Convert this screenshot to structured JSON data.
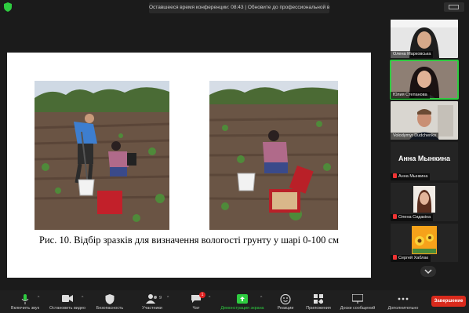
{
  "banner": {
    "text": "Оставшееся время конференции: 08:43 | Обновите до профессиональной версии"
  },
  "slide": {
    "caption": "Рис. 10. Відбір зразків для визначення вологості грунту у шарі 0-100 см"
  },
  "participants": [
    {
      "name": "Олена Марковська",
      "video": true,
      "active": false,
      "muted": false
    },
    {
      "name": "Юлия Степанова",
      "video": true,
      "active": true,
      "muted": false
    },
    {
      "name": "Volodymyr Dudchenko",
      "video": true,
      "active": false,
      "muted": false
    },
    {
      "name": "Анна Мынкина",
      "display_name": "Анна Мынкина",
      "video": false,
      "active": false,
      "muted": true
    },
    {
      "name": "Олена Сидакіна",
      "video": true,
      "active": false,
      "muted": true
    },
    {
      "name": "Сергей Хаблак",
      "video": true,
      "active": false,
      "muted": true
    }
  ],
  "toolbar": {
    "mute": "Включить звук",
    "video": "Остановить видео",
    "security": "Безопасность",
    "participants": "Участники",
    "participants_count": "9",
    "chat": "Чат",
    "chat_badge": "1",
    "share": "Демонстрация экрана",
    "reactions": "Реакции",
    "apps": "Приложения",
    "whiteboards": "Доски сообщений",
    "more": "Дополнительно",
    "end": "Завершение"
  },
  "colors": {
    "accent_green": "#2ecc40",
    "end_red": "#d92a1c"
  }
}
